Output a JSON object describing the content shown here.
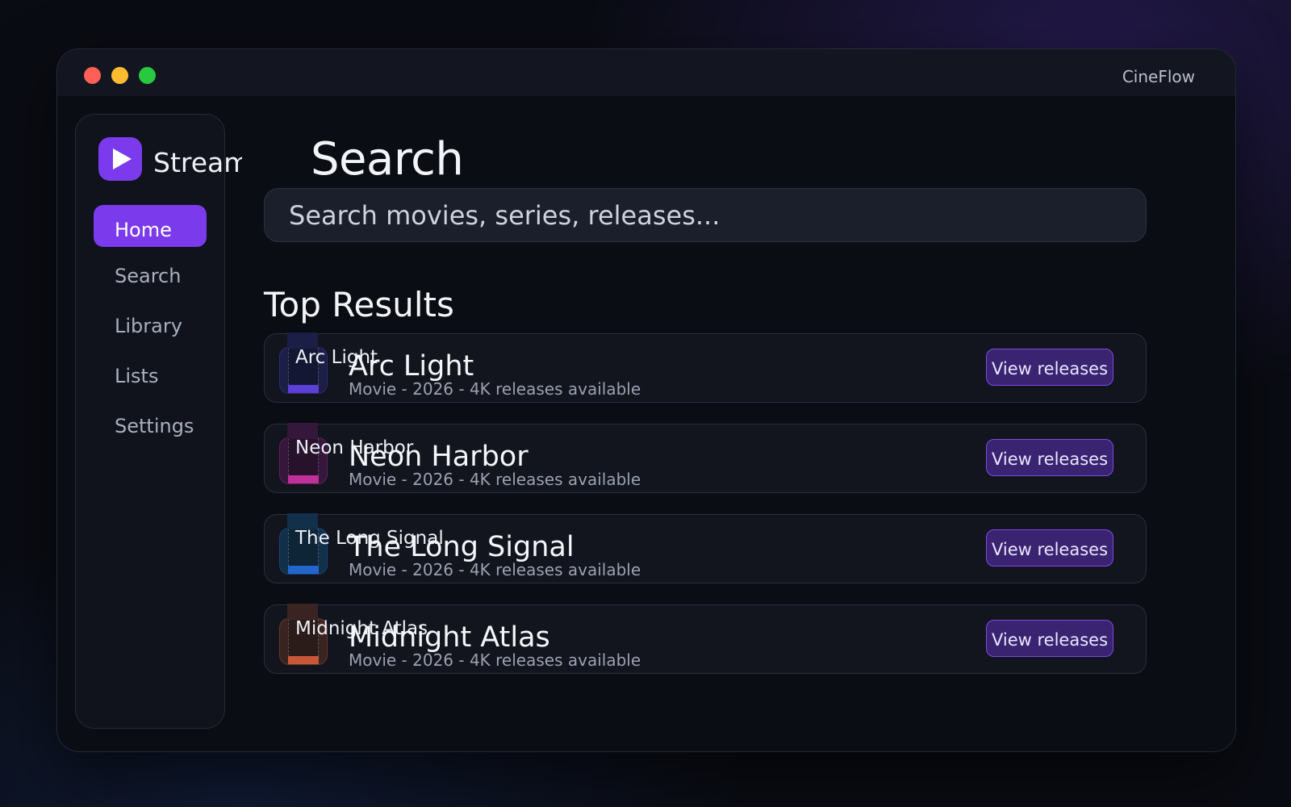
{
  "window": {
    "app_title": "CineFlow"
  },
  "sidebar": {
    "brand_name": "Stream",
    "brand_icon": "play-icon",
    "items": [
      {
        "label": "Home",
        "active": true
      },
      {
        "label": "Search",
        "active": false
      },
      {
        "label": "Library",
        "active": false
      },
      {
        "label": "Lists",
        "active": false
      },
      {
        "label": "Settings",
        "active": false
      }
    ]
  },
  "main": {
    "title": "Search",
    "search": {
      "value": "",
      "placeholder": "Search movies, series, releases..."
    },
    "section_title": "Top Results",
    "results": [
      {
        "poster_label": "Arc Light",
        "title": "Arc Light",
        "meta": "Movie - 2026 - 4K releases available",
        "button_label": "View releases",
        "color": "#5b3fd6",
        "bg": "#1b1f45"
      },
      {
        "poster_label": "Neon Harbor",
        "title": "Neon Harbor",
        "meta": "Movie - 2026 - 4K releases available",
        "button_label": "View releases",
        "color": "#c0309a",
        "bg": "#34173a"
      },
      {
        "poster_label": "The Long Signal",
        "title": "The Long Signal",
        "meta": "Movie - 2026 - 4K releases available",
        "button_label": "View releases",
        "color": "#2266cc",
        "bg": "#13304a"
      },
      {
        "poster_label": "Midnight Atlas",
        "title": "Midnight Atlas",
        "meta": "Movie - 2026 - 4K releases available",
        "button_label": "View releases",
        "color": "#c8573a",
        "bg": "#3a2422"
      }
    ]
  },
  "colors": {
    "accent": "#7c3aed",
    "background": "#0b0d14",
    "button_bg": "#3a2370"
  }
}
